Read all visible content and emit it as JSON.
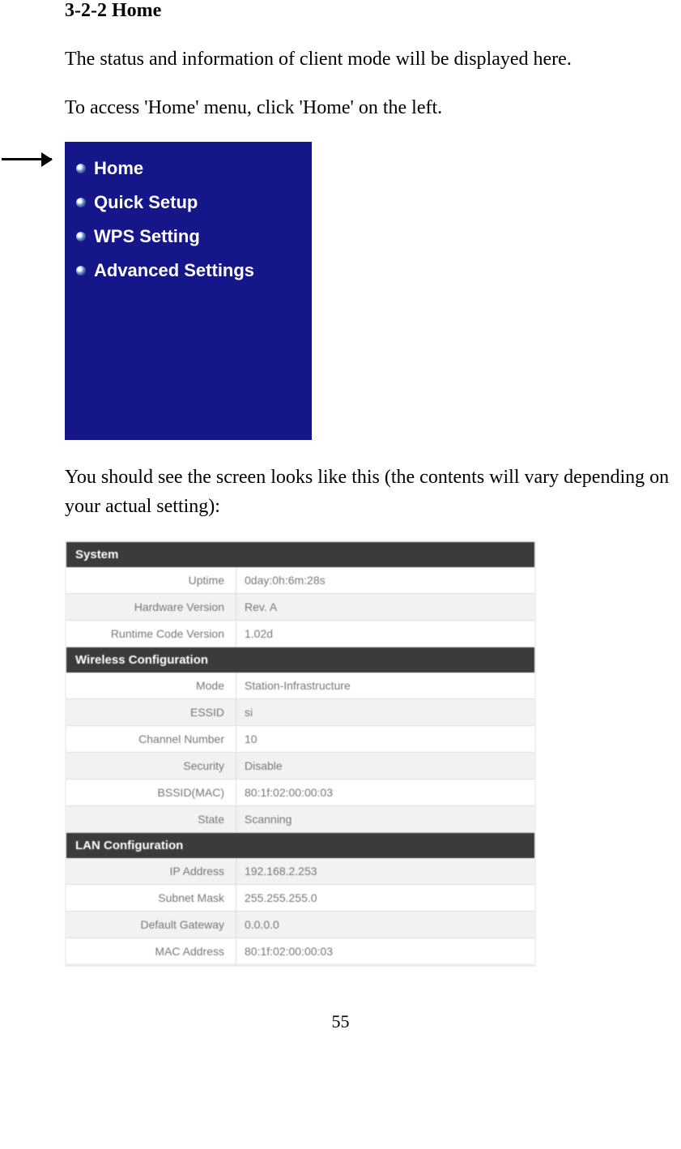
{
  "heading": "3-2-2 Home",
  "para1": "The status and information of client mode will be displayed here.",
  "para2": "To access 'Home' menu, click 'Home' on the left.",
  "menu": {
    "items": [
      "Home",
      "Quick Setup",
      "WPS Setting",
      "Advanced Settings"
    ]
  },
  "para3": "You should see the screen looks like this (the contents will vary depending on your actual setting):",
  "status": {
    "system": {
      "header": "System",
      "rows": [
        {
          "label": "Uptime",
          "value": "0day:0h:6m:28s"
        },
        {
          "label": "Hardware Version",
          "value": "Rev. A"
        },
        {
          "label": "Runtime Code Version",
          "value": "1.02d"
        }
      ]
    },
    "wireless": {
      "header": "Wireless Configuration",
      "rows": [
        {
          "label": "Mode",
          "value": "Station-Infrastructure"
        },
        {
          "label": "ESSID",
          "value": "si"
        },
        {
          "label": "Channel Number",
          "value": "10"
        },
        {
          "label": "Security",
          "value": "Disable"
        },
        {
          "label": "BSSID(MAC)",
          "value": "80:1f:02:00:00:03"
        },
        {
          "label": "State",
          "value": "Scanning"
        }
      ]
    },
    "lan": {
      "header": "LAN Configuration",
      "rows": [
        {
          "label": "IP Address",
          "value": "192.168.2.253"
        },
        {
          "label": "Subnet Mask",
          "value": "255.255.255.0"
        },
        {
          "label": "Default Gateway",
          "value": "0.0.0.0"
        },
        {
          "label": "MAC Address",
          "value": "80:1f:02:00:00:03"
        }
      ]
    }
  },
  "page": "55"
}
